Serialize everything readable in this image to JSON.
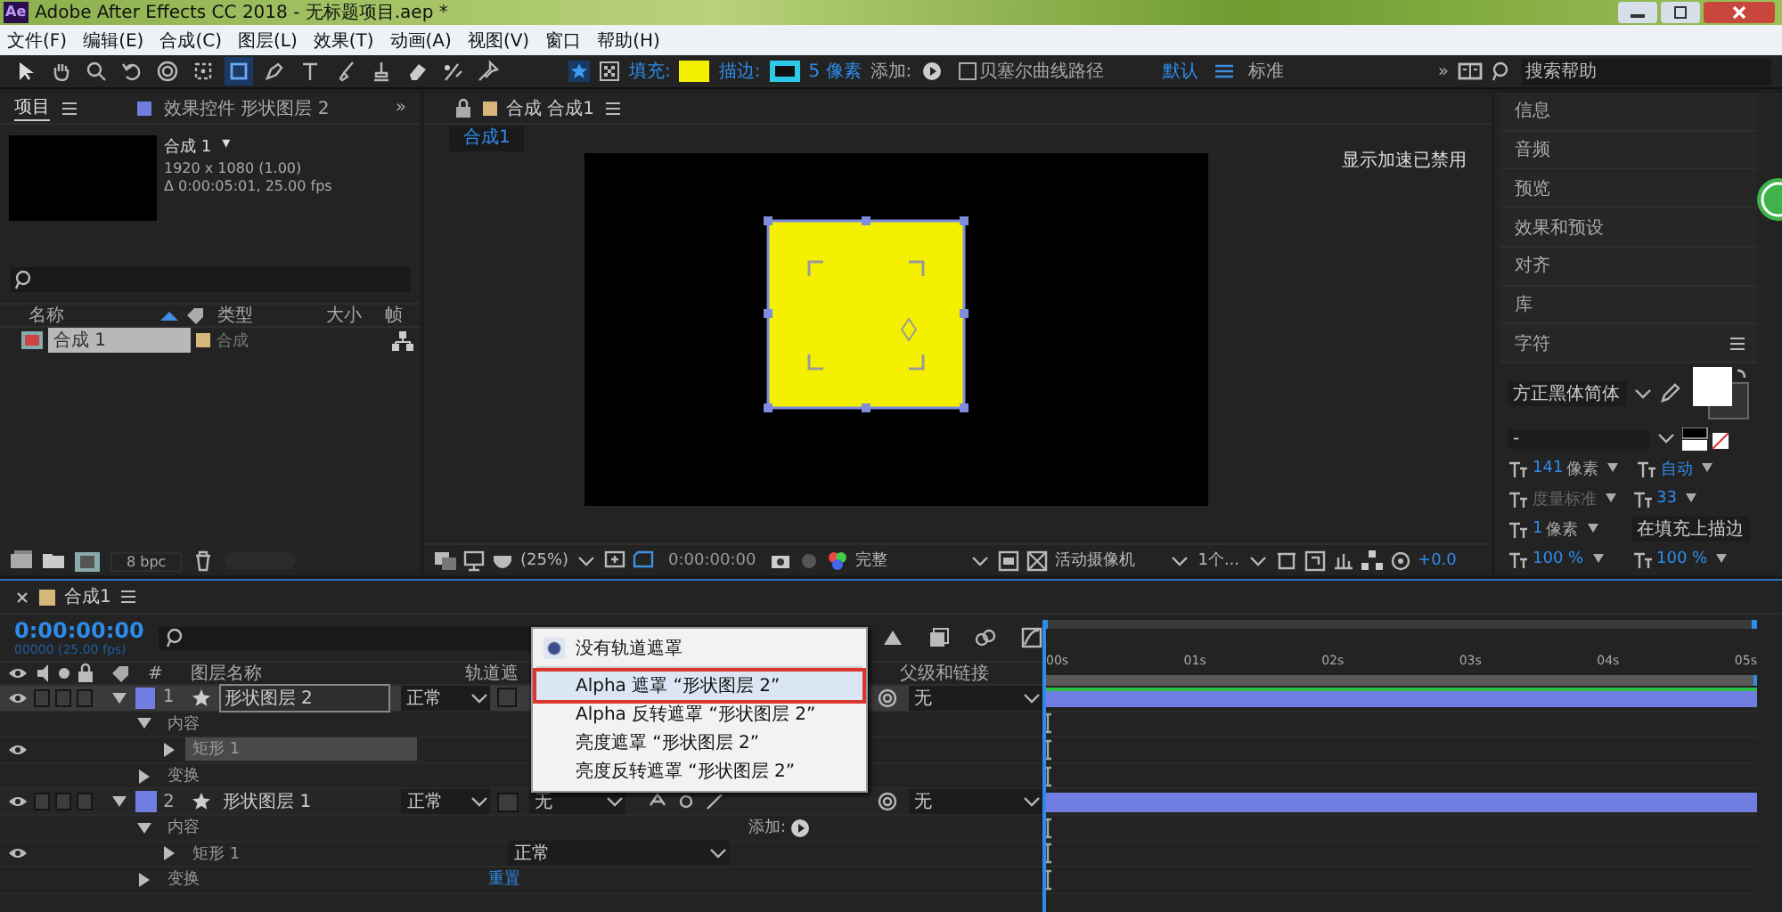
{
  "window": {
    "app_icon": "Ae",
    "title": "Adobe After Effects CC 2018 - 无标题项目.aep *"
  },
  "menu": [
    "文件(F)",
    "编辑(E)",
    "合成(C)",
    "图层(L)",
    "效果(T)",
    "动画(A)",
    "视图(V)",
    "窗口",
    "帮助(H)"
  ],
  "toolbar": {
    "tools": [
      {
        "kind": "arrow",
        "selected": false
      },
      {
        "kind": "hand",
        "selected": false
      },
      {
        "kind": "zoom",
        "selected": false
      },
      {
        "kind": "rotate",
        "selected": false
      },
      {
        "kind": "orbit",
        "selected": false
      },
      {
        "kind": "pan",
        "selected": false
      },
      {
        "kind": "rect",
        "selected": true
      },
      {
        "kind": "pen",
        "selected": false
      },
      {
        "kind": "text",
        "selected": false
      },
      {
        "kind": "brush",
        "selected": false
      },
      {
        "kind": "stamp",
        "selected": false
      },
      {
        "kind": "eraser",
        "selected": false
      },
      {
        "kind": "roto",
        "selected": false
      },
      {
        "kind": "pin",
        "selected": false
      }
    ],
    "fill": {
      "label": "填充:",
      "color": "#f5f000"
    },
    "stroke": {
      "label": "描边:",
      "color": "#2ec8e8"
    },
    "stroke_width": "5 像素",
    "add_label": "添加:",
    "bezier": {
      "label": "贝塞尔曲线路径",
      "checked": false
    },
    "workspaces": [
      {
        "label": "默认",
        "selected": true
      },
      {
        "label": "标准",
        "selected": false
      }
    ],
    "more": "»",
    "search": {
      "placeholder": "搜索帮助"
    }
  },
  "project_panel": {
    "tabs": [
      {
        "label": "项目",
        "selected": true
      },
      {
        "label": "效果控件 形状图层 2",
        "selected": false
      }
    ],
    "more": "»",
    "comp_name": "合成 1",
    "comp_caret": "▾",
    "details": [
      "1920 x 1080 (1.00)",
      "Δ 0:00:05:01, 25.00 fps"
    ],
    "columns": [
      "名称",
      "类型",
      "大小",
      "帧"
    ],
    "items": [
      {
        "name": "合成 1",
        "type": "合成",
        "selected": true
      }
    ],
    "bpc": "8 bpc"
  },
  "viewer": {
    "title": "合成 合成1",
    "tabs": [
      {
        "label": "合成1",
        "selected": true
      }
    ],
    "notice": "显示加速已禁用",
    "zoom": "(25%)",
    "time": "0:00:00:00",
    "resolution": "完整",
    "camera": "活动摄像机",
    "views": "1个...",
    "exposure": "+0.0"
  },
  "side_panels": [
    {
      "label": "信息"
    },
    {
      "label": "音频"
    },
    {
      "label": "预览"
    },
    {
      "label": "效果和预设"
    },
    {
      "label": "对齐"
    },
    {
      "label": "库"
    },
    {
      "label": "字符"
    }
  ],
  "character": {
    "font": "方正黑体简体",
    "style": "-",
    "size": {
      "value": "141",
      "unit": "像素"
    },
    "leading": "自动",
    "kerning": "度量标准",
    "tracking": "33",
    "stroke_width": {
      "value": "1",
      "unit": "像素"
    },
    "stroke_mode": "在填充上描边",
    "vertical_scale": "100 %",
    "horizontal_scale": "100 %"
  },
  "timeline": {
    "comp": "合成1",
    "time": "0:00:00:00",
    "frames": "00000 (25.00 fps)",
    "columns": [
      "#",
      "图层名称",
      "轨道遮",
      "父级和链接"
    ],
    "ruler": [
      "00s",
      "01s",
      "02s",
      "03s",
      "04s",
      "05s"
    ],
    "layers": [
      {
        "number": "1",
        "name": "形状图层 2",
        "mode": "正常",
        "parent": "无",
        "selected": true,
        "expanded": true,
        "color": "#6f7ee0",
        "children": [
          {
            "name": "内容",
            "expanded": true,
            "children": [
              {
                "name": "矩形 1",
                "expanded": false,
                "selected": true
              }
            ]
          },
          {
            "name": "变换",
            "expanded": false
          }
        ]
      },
      {
        "number": "2",
        "name": "形状图层 1",
        "mode": "正常",
        "matte": "无",
        "parent": "无",
        "selected": false,
        "expanded": true,
        "color": "#6f7ee0",
        "children": [
          {
            "name": "内容",
            "expanded": true,
            "add_label": "添加:",
            "children": [
              {
                "name": "矩形 1",
                "expanded": false,
                "selected": false,
                "blend": "正常"
              }
            ]
          },
          {
            "name": "变换",
            "expanded": false,
            "reset": "重置"
          }
        ]
      }
    ]
  },
  "matte_menu": [
    {
      "label": "没有轨道遮罩",
      "selected": true,
      "hovered": false
    },
    {
      "label": "Alpha 遮罩 “形状图层 2”",
      "selected": false,
      "hovered": true
    },
    {
      "label": "Alpha 反转遮罩 “形状图层 2”",
      "selected": false,
      "hovered": false
    },
    {
      "label": "亮度遮罩 “形状图层 2”",
      "selected": false,
      "hovered": false
    },
    {
      "label": "亮度反转遮罩 “形状图层 2”",
      "selected": false,
      "hovered": false
    }
  ]
}
